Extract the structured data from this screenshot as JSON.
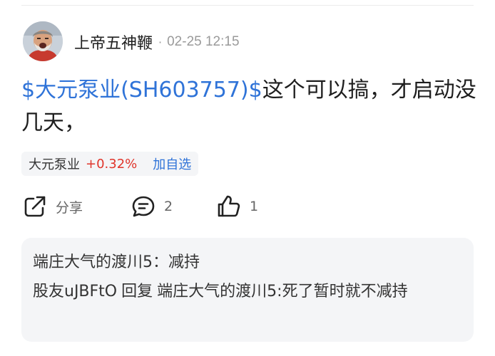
{
  "author": {
    "name": "上帝五神鞭",
    "separator": "·",
    "time": "02-25 12:15"
  },
  "post": {
    "stock_tag": "$大元泵业(SH603757)$",
    "text": "这个可以搞，才启动没几天，"
  },
  "stock_chip": {
    "name": "大元泵业",
    "change": "+0.32%",
    "add_label": "加自选"
  },
  "actions": {
    "share_label": "分享",
    "comment_count": "2",
    "like_count": "1"
  },
  "replies": [
    {
      "user": "端庄大气的渡川5",
      "separator": "：",
      "text": "减持"
    },
    {
      "user": "股友uJBFtO",
      "reply_word": "回复",
      "target": "端庄大气的渡川5",
      "separator": ":",
      "text": "死了暂时就不减持"
    }
  ],
  "colors": {
    "link": "#2f73d8",
    "rise": "#e0352b",
    "muted": "#9a9a9a",
    "panel": "#f4f5f7"
  },
  "icons": {
    "share": "share-icon",
    "comment": "comment-icon",
    "like": "thumbs-up-icon",
    "avatar": "user-avatar"
  }
}
